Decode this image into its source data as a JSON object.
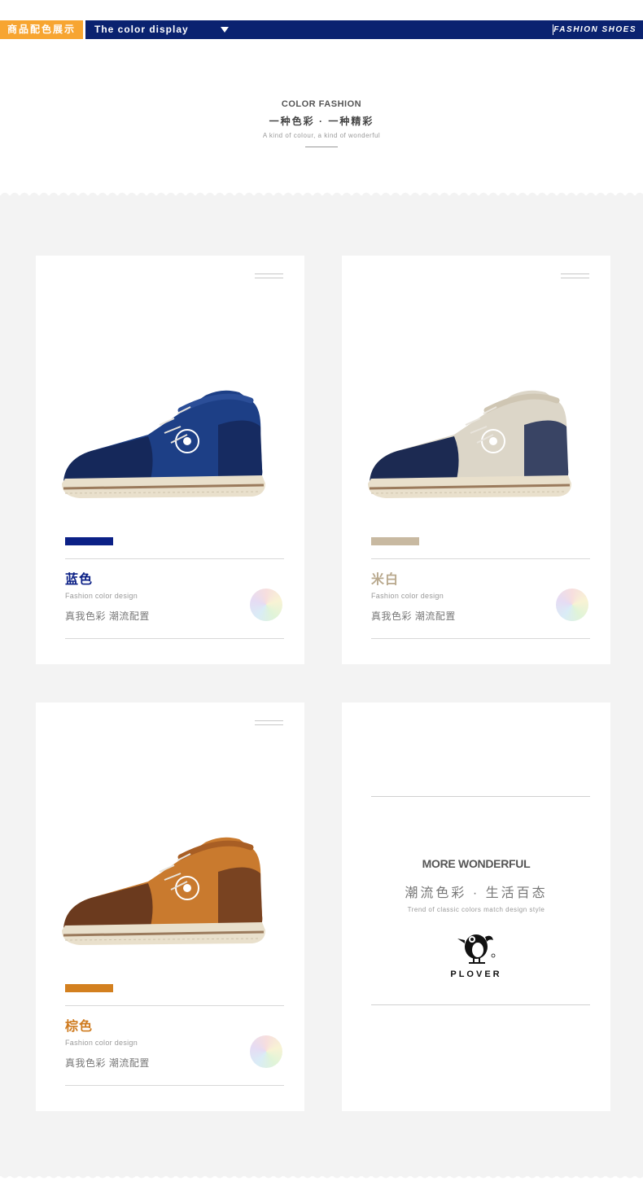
{
  "header": {
    "tag_cn": "商品配色展示",
    "title": "The color display",
    "right_label": "FASHION SHOES"
  },
  "intro": {
    "title_en": "COLOR FASHION",
    "title_cn": "一种色彩 · 一种精彩",
    "subtitle": "A kind of colour, a kind of wonderful"
  },
  "products": [
    {
      "name": "蓝色",
      "en_sub": "Fashion color design",
      "cn_sub": "真我色彩  潮流配置",
      "swatch_color": "#0b2086",
      "name_color": "#0b2086",
      "upper": "#1d3f86",
      "upper_dark": "#15285a",
      "accent": "#2b4e98"
    },
    {
      "name": "米白",
      "en_sub": "Fashion color design",
      "cn_sub": "真我色彩  潮流配置",
      "swatch_color": "#c8b9a1",
      "name_color": "#b9a98e",
      "upper": "#dcd6c8",
      "upper_dark": "#1c2a52",
      "accent": "#cfc6b3"
    },
    {
      "name": "棕色",
      "en_sub": "Fashion color design",
      "cn_sub": "真我色彩  潮流配置",
      "swatch_color": "#d3801f",
      "name_color": "#cf7b1f",
      "upper": "#c97a2e",
      "upper_dark": "#6b3a1e",
      "accent": "#a85e24"
    }
  ],
  "promo": {
    "title": "MORE WONDERFUL",
    "slogan": "潮流色彩 · 生活百态",
    "trend": "Trend of classic colors match design style",
    "brand": "PLOVER"
  }
}
